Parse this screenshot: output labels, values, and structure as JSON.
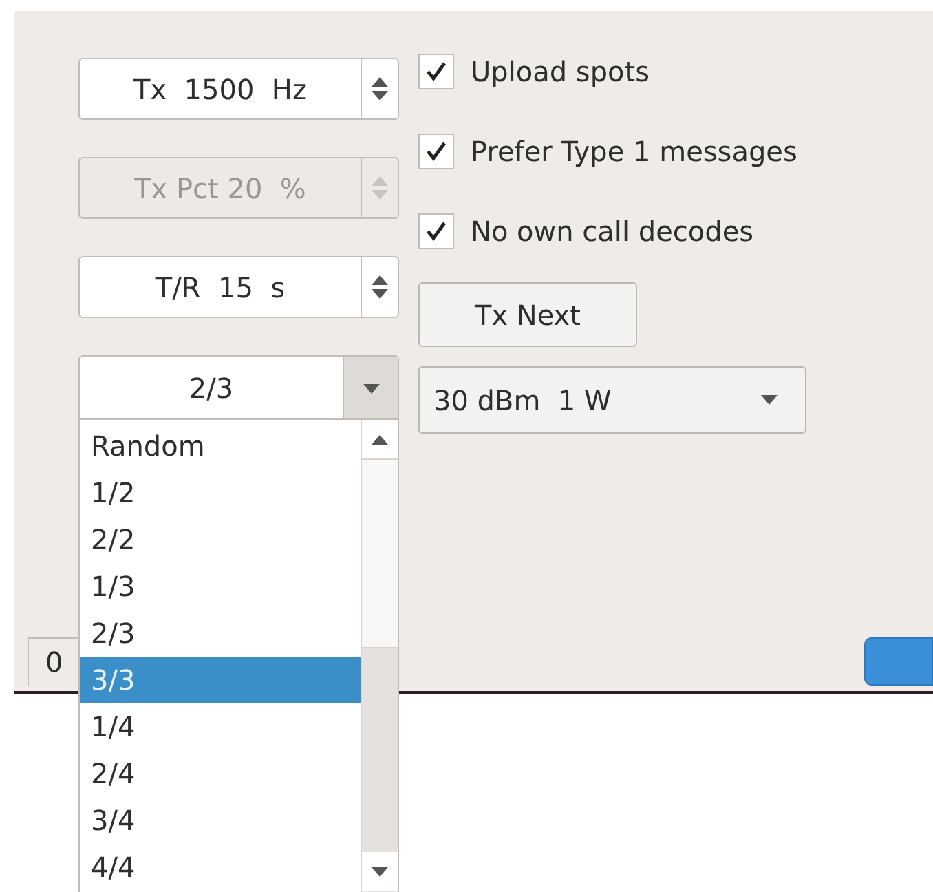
{
  "spin_boxes": [
    {
      "value": "Tx  1500  Hz",
      "disabled": false
    },
    {
      "value": "Tx Pct 20  %",
      "disabled": true
    },
    {
      "value": "T/R  15  s",
      "disabled": false
    }
  ],
  "sequence_combo": {
    "value": "2/3",
    "expanded": true
  },
  "checkboxes": [
    {
      "label": "Upload spots",
      "checked": true
    },
    {
      "label": "Prefer Type 1 messages",
      "checked": true
    },
    {
      "label": "No own call decodes",
      "checked": true
    }
  ],
  "tx_next_button": "Tx Next",
  "power_combo": {
    "value": "30 dBm  1 W"
  },
  "bottom_tab": "0",
  "dropdown_list": [
    {
      "label": "Random",
      "selected": false
    },
    {
      "label": "1/2",
      "selected": false
    },
    {
      "label": "2/2",
      "selected": false
    },
    {
      "label": "1/3",
      "selected": false
    },
    {
      "label": "2/3",
      "selected": false
    },
    {
      "label": "3/3",
      "selected": true
    },
    {
      "label": "1/4",
      "selected": false
    },
    {
      "label": "2/4",
      "selected": false
    },
    {
      "label": "3/4",
      "selected": false
    },
    {
      "label": "4/4",
      "selected": false
    }
  ]
}
